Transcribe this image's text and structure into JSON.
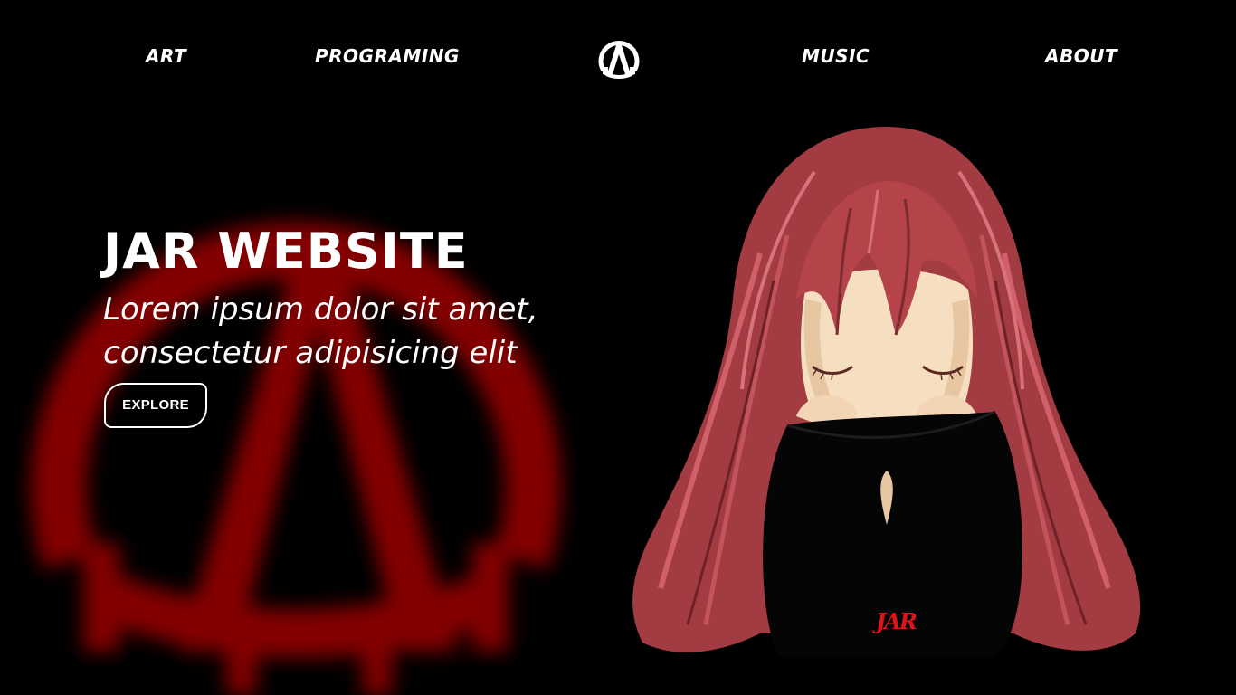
{
  "nav": {
    "links": [
      "ART",
      "PROGRAMING",
      "MUSIC",
      "ABOUT"
    ],
    "logo_icon": "anarchy-a-logo-icon"
  },
  "hero": {
    "title": "JAR WEBSITE",
    "subtitle": "Lorem ipsum dolor sit amet, consectetur adipisicing elit",
    "button_label": "EXPLORE"
  },
  "illustration": {
    "signature": "JAR",
    "icon": "red-haired-girl-illustration"
  },
  "colors": {
    "background": "#000000",
    "accent_red": "#8b0000",
    "signature_red": "#e0141b",
    "text": "#ffffff",
    "hair": "#b5434a",
    "skin": "#f6dfc1"
  }
}
